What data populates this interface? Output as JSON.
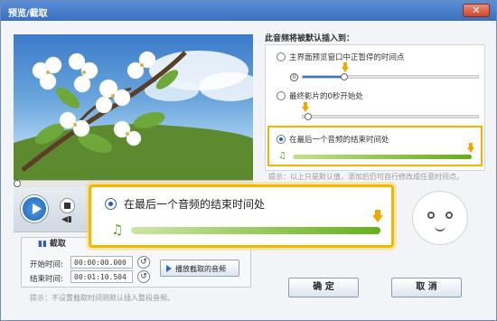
{
  "window": {
    "title": "预览/截取",
    "close_label": "✕"
  },
  "player": {
    "play_icon": "play-icon",
    "stop_icon": "stop-icon",
    "volume_icon": "volume-icon"
  },
  "clip": {
    "tab_label": "截取",
    "start_label": "开始时间:",
    "start_value": "00:00:00.000",
    "end_label": "结束时间:",
    "end_value": "00:01:10.504",
    "play_button": "播放截取的音频",
    "hint": "提示：不设置截取时间则默认插入整段音频。"
  },
  "insert": {
    "title": "此音频将被默认插入到：",
    "options": [
      {
        "label": "主界面预览窗口中正暂停的时间点",
        "selected": false
      },
      {
        "label": "最终影片的0秒开始处",
        "selected": false
      },
      {
        "label": "在最后一个音频的结束时间处",
        "selected": true
      }
    ],
    "hint": "提示：以上只是默认值，添加后仍可自行修改成任意时间点。"
  },
  "callout": {
    "label": "在最后一个音频的结束时间处"
  },
  "buttons": {
    "ok": "确 定",
    "cancel": "取 消"
  },
  "colors": {
    "highlight": "#f4b700",
    "title_bar": "#3a6fbf",
    "music_bar": "#62ae16"
  }
}
